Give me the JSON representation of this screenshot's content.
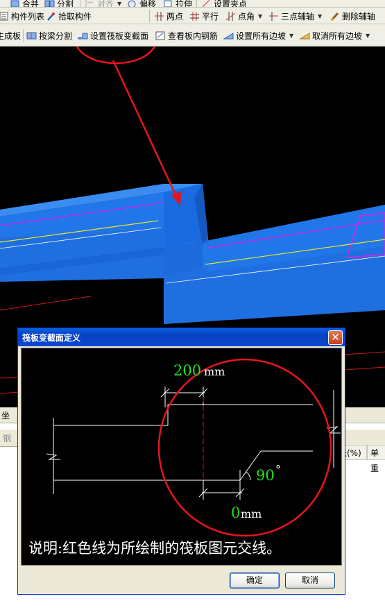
{
  "toolbar1": {
    "items": [
      {
        "label": "合并",
        "icon": "merge-icon",
        "enabled": true
      },
      {
        "label": "分割",
        "icon": "split-icon",
        "enabled": true
      },
      {
        "label": "对齐",
        "icon": "align-icon",
        "enabled": false
      },
      {
        "label": "偏移",
        "icon": "offset-icon",
        "enabled": true
      },
      {
        "label": "拉伸",
        "icon": "stretch-icon",
        "enabled": true
      },
      {
        "label": "设置夹点",
        "icon": "grip-point-icon",
        "enabled": true
      }
    ]
  },
  "toolbar2": {
    "component_list": "构件列表",
    "pick_component": "拾取构件",
    "two_points": "两点",
    "parallel": "平行",
    "point_angle": "点角",
    "three_point_axis": "三点辅轴",
    "delete_axis": "删除辅轴"
  },
  "toolbar3": {
    "generate_slab": "生成板",
    "split_by_beam": "按梁分割",
    "set_raft_section": "设置筏板变截面",
    "view_rebar": "查看板内钢筋",
    "set_all_slopes": "设置所有边坡",
    "cancel_all_slopes": "取消所有边坡"
  },
  "lower_panel": {
    "tab1": "坐",
    "tab2": "钢",
    "col1": "长(%)",
    "col2": "单重"
  },
  "dialog": {
    "title": "筏板变截面定义",
    "width_value": "200",
    "width_unit": "mm",
    "offset_value": "0",
    "offset_unit": "mm",
    "angle_value": "90",
    "angle_unit": "°",
    "note": "说明:红色线为所绘制的筏板图元交线。",
    "ok_label": "确定",
    "cancel_label": "取消"
  },
  "colors": {
    "annotation_red": "#e8141c",
    "slab_blue": "#1f6fe0",
    "dim_green": "#21e021",
    "title_blue": "#0a4fd8"
  }
}
